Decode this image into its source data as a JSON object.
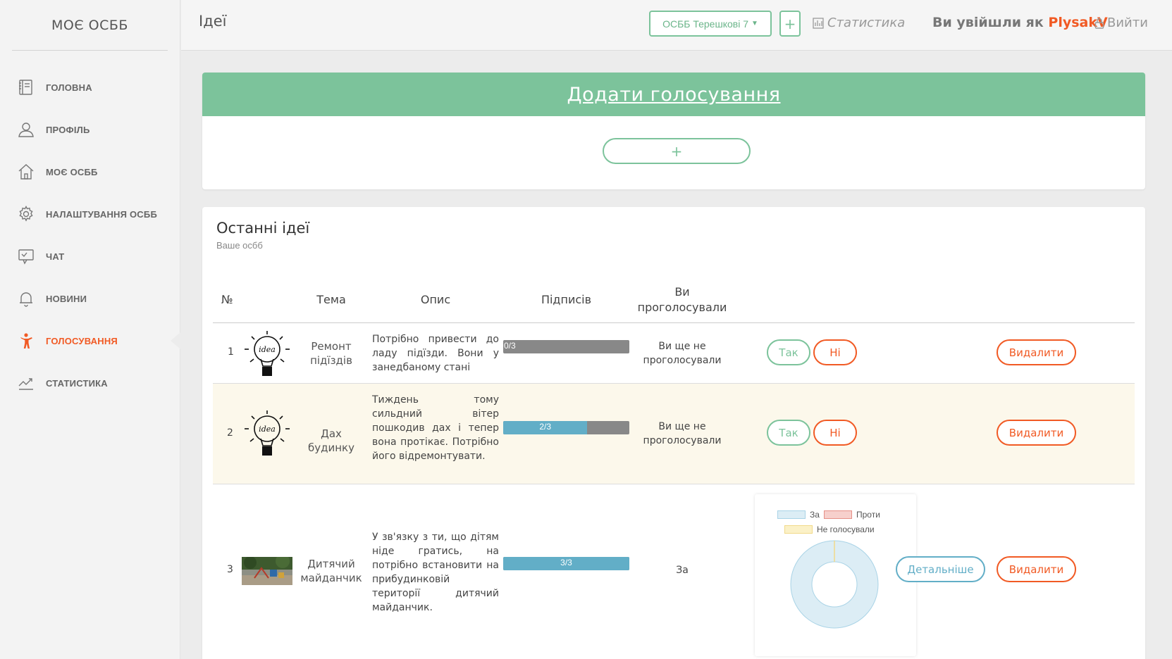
{
  "brand": "МОЄ ОСББ",
  "nav": [
    {
      "label": "Головна",
      "icon": "book-icon"
    },
    {
      "label": "Профіль",
      "icon": "user-icon"
    },
    {
      "label": "Моє ОСББ",
      "icon": "home-icon"
    },
    {
      "label": "Налаштування ОСББ",
      "icon": "gear-icon"
    },
    {
      "label": "Чат",
      "icon": "chat-icon"
    },
    {
      "label": "Новини",
      "icon": "bell-icon"
    },
    {
      "label": "Голосування",
      "icon": "person-vote-icon",
      "active": true
    },
    {
      "label": "Статистика",
      "icon": "trend-icon"
    }
  ],
  "topbar": {
    "title": "Ідеї",
    "osbb_select": "ОСББ Терешкові 7",
    "add_label": "+",
    "stats_label": "Статистика",
    "logged_prefix": "Ви увійшли як",
    "username": "PlysakV",
    "logout_label": "Вийти"
  },
  "add_vote": {
    "title": "Додати голосування",
    "button": "+"
  },
  "ideas": {
    "title": "Останні ідеї",
    "subtitle": "Ваше осбб",
    "columns": [
      "№",
      "Тема",
      "Опис",
      "Підписів",
      "Ви проголосували"
    ],
    "rows": [
      {
        "num": "1",
        "image": "idea-bulb",
        "topic": "Ремонт підїздів",
        "description": "Потрібно привести до ладу підїзди. Вони у занедбаному стані",
        "signatures_text": "0/3",
        "signatures_fraction": 0,
        "voted": "Ви ще не проголосували",
        "yes_label": "Так",
        "no_label": "Ні",
        "delete_label": "Видалити"
      },
      {
        "num": "2",
        "image": "idea-bulb",
        "topic": "Дах будинку",
        "description": "Тиждень тому сильдний вітер пошкодив дах і тепер вона протікає. Потрібно його відремонтувати.",
        "signatures_text": "2/3",
        "signatures_fraction": 0.667,
        "voted": "Ви ще не проголосували",
        "yes_label": "Так",
        "no_label": "Ні",
        "delete_label": "Видалити"
      },
      {
        "num": "3",
        "image": "playground-photo",
        "topic": "Дитячий майданчик",
        "description": "У зв'язку з ти, що дітям ніде гратись, на потрібно встановити на прибудинковій території дитячий майданчик.",
        "signatures_text": "3/3",
        "signatures_fraction": 1,
        "voted": "За",
        "details_label": "Детальніше",
        "delete_label": "Видалити",
        "chart": {
          "legend": [
            {
              "label": "За",
              "color": "#dcedf5",
              "border": "#a9d3e6"
            },
            {
              "label": "Проти",
              "color": "#f7d0cc",
              "border": "#e69087"
            },
            {
              "label": "Не голосували",
              "color": "#fbf1c7",
              "border": "#f1d98a"
            }
          ]
        }
      }
    ]
  },
  "chart_data": {
    "type": "pie",
    "categories": [
      "За",
      "Проти",
      "Не голосували"
    ],
    "values": [
      3,
      0,
      0
    ]
  }
}
